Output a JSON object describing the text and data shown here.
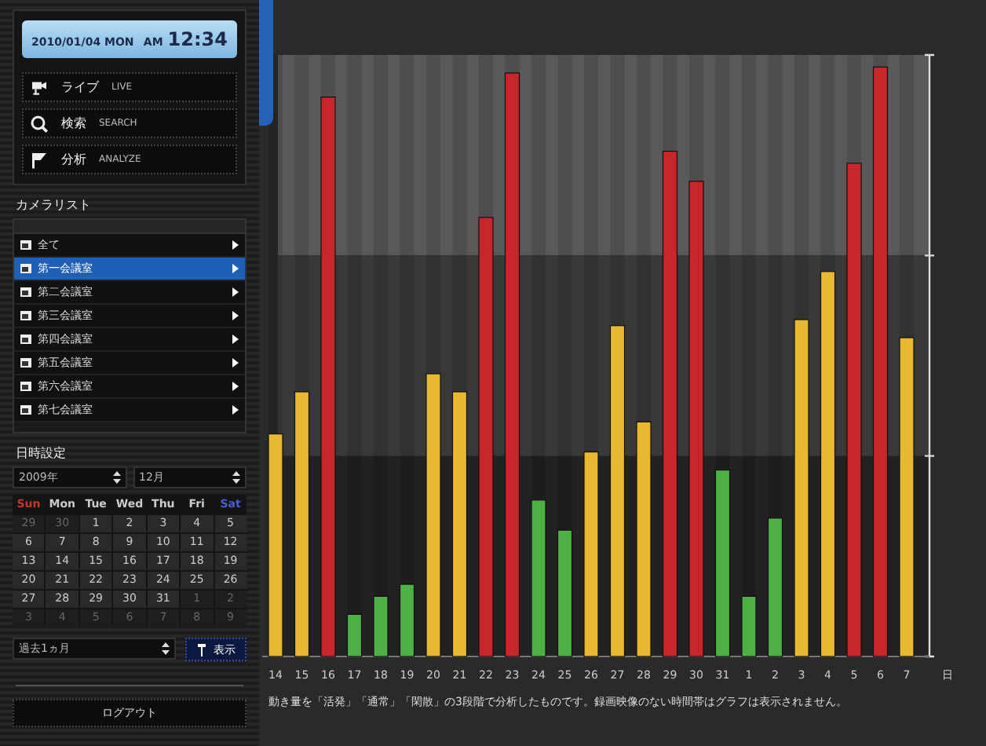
{
  "clock": {
    "date": "2010/01/04 MON",
    "ampm": "AM",
    "time": "12:34"
  },
  "menu": [
    {
      "kind": "camera",
      "jp": "ライブ",
      "en": "LIVE"
    },
    {
      "kind": "search",
      "jp": "検索",
      "en": "SEARCH"
    },
    {
      "kind": "flag",
      "jp": "分析",
      "en": "ANALYZE"
    }
  ],
  "camera_list": {
    "title": "カメラリスト",
    "items": [
      {
        "label": "全て",
        "selected": false
      },
      {
        "label": "第一会議室",
        "selected": true
      },
      {
        "label": "第二会議室",
        "selected": false
      },
      {
        "label": "第三会議室",
        "selected": false
      },
      {
        "label": "第四会議室",
        "selected": false
      },
      {
        "label": "第五会議室",
        "selected": false
      },
      {
        "label": "第六会議室",
        "selected": false
      },
      {
        "label": "第七会議室",
        "selected": false
      }
    ]
  },
  "date_settings": {
    "title": "日時設定",
    "year": "2009年",
    "month": "12月",
    "weekdays": [
      {
        "label": "Sun",
        "color": "#c0392b"
      },
      {
        "label": "Mon",
        "color": "#cccccc"
      },
      {
        "label": "Tue",
        "color": "#cccccc"
      },
      {
        "label": "Wed",
        "color": "#cccccc"
      },
      {
        "label": "Thu",
        "color": "#cccccc"
      },
      {
        "label": "Fri",
        "color": "#cccccc"
      },
      {
        "label": "Sat",
        "color": "#4a5ad0"
      }
    ],
    "days": [
      {
        "label": "29",
        "other_month": true
      },
      {
        "label": "30",
        "other_month": true
      },
      {
        "label": "1",
        "other_month": false
      },
      {
        "label": "2",
        "other_month": false
      },
      {
        "label": "3",
        "other_month": false
      },
      {
        "label": "4",
        "other_month": false
      },
      {
        "label": "5",
        "other_month": false
      },
      {
        "label": "6",
        "other_month": false
      },
      {
        "label": "7",
        "other_month": false
      },
      {
        "label": "8",
        "other_month": false
      },
      {
        "label": "9",
        "other_month": false
      },
      {
        "label": "10",
        "other_month": false
      },
      {
        "label": "11",
        "other_month": false
      },
      {
        "label": "12",
        "other_month": false
      },
      {
        "label": "13",
        "other_month": false
      },
      {
        "label": "14",
        "other_month": false
      },
      {
        "label": "15",
        "other_month": false
      },
      {
        "label": "16",
        "other_month": false
      },
      {
        "label": "17",
        "other_month": false
      },
      {
        "label": "18",
        "other_month": false
      },
      {
        "label": "19",
        "other_month": false
      },
      {
        "label": "20",
        "other_month": false
      },
      {
        "label": "21",
        "other_month": false
      },
      {
        "label": "22",
        "other_month": false
      },
      {
        "label": "23",
        "other_month": false
      },
      {
        "label": "24",
        "other_month": false
      },
      {
        "label": "25",
        "other_month": false
      },
      {
        "label": "26",
        "other_month": false
      },
      {
        "label": "27",
        "other_month": false
      },
      {
        "label": "28",
        "other_month": false
      },
      {
        "label": "29",
        "other_month": false
      },
      {
        "label": "30",
        "other_month": false
      },
      {
        "label": "31",
        "other_month": false
      },
      {
        "label": "1",
        "other_month": true
      },
      {
        "label": "2",
        "other_month": true
      },
      {
        "label": "3",
        "other_month": true
      },
      {
        "label": "4",
        "other_month": true
      },
      {
        "label": "5",
        "other_month": true
      },
      {
        "label": "6",
        "other_month": true
      },
      {
        "label": "7",
        "other_month": true
      },
      {
        "label": "8",
        "other_month": true
      },
      {
        "label": "9",
        "other_month": true
      }
    ],
    "period": "過去1ヵ月",
    "show_button": "表示"
  },
  "logout_button": "ログアウト",
  "activity_chart": {
    "unit_label": "日",
    "bars": [
      {
        "label": "14",
        "level": 0.37
      },
      {
        "label": "15",
        "level": 0.44
      },
      {
        "label": "16",
        "level": 0.93
      },
      {
        "label": "17",
        "level": 0.07
      },
      {
        "label": "18",
        "level": 0.1
      },
      {
        "label": "19",
        "level": 0.12
      },
      {
        "label": "20",
        "level": 0.47
      },
      {
        "label": "21",
        "level": 0.44
      },
      {
        "label": "22",
        "level": 0.73
      },
      {
        "label": "23",
        "level": 0.97
      },
      {
        "label": "24",
        "level": 0.26
      },
      {
        "label": "25",
        "level": 0.21
      },
      {
        "label": "26",
        "level": 0.34
      },
      {
        "label": "27",
        "level": 0.55
      },
      {
        "label": "28",
        "level": 0.39
      },
      {
        "label": "29",
        "level": 0.84
      },
      {
        "label": "30",
        "level": 0.79
      },
      {
        "label": "31",
        "level": 0.31
      },
      {
        "label": "1",
        "level": 0.1
      },
      {
        "label": "2",
        "level": 0.23
      },
      {
        "label": "3",
        "level": 0.56
      },
      {
        "label": "4",
        "level": 0.64
      },
      {
        "label": "5",
        "level": 0.82
      },
      {
        "label": "6",
        "level": 0.98
      },
      {
        "label": "7",
        "level": 0.53
      }
    ],
    "note": "動き量を「活発」「通常」「閑散」の3段階で分析したものです。録画映像のない時間帯はグラフは表示されません。"
  }
}
